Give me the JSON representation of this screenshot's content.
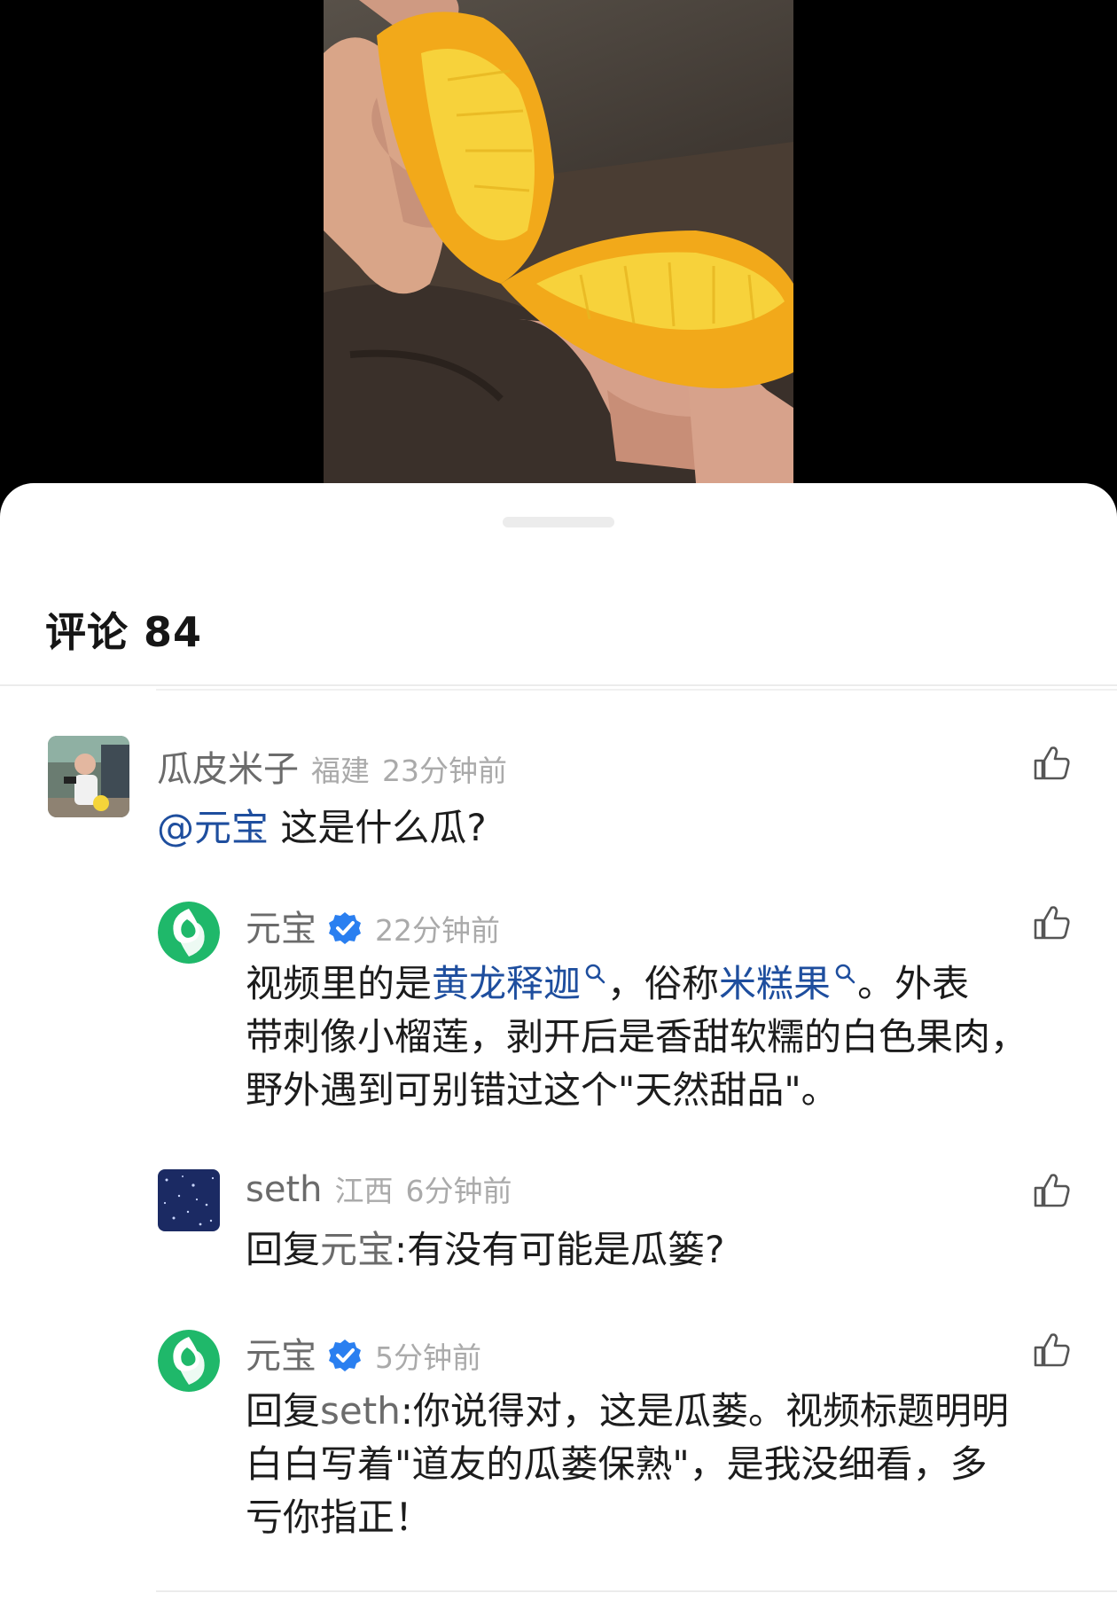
{
  "sheet": {
    "title": "评论 84"
  },
  "comments": [
    {
      "name": "瓜皮米子",
      "region": "福建",
      "time": "23分钟前",
      "mention": "@元宝",
      "text": " 这是什么瓜?"
    },
    {
      "name": "元宝",
      "verified": true,
      "time": "22分钟前",
      "lines": {
        "line1_a": "视频里的是",
        "line1_link1": "黄龙释迦",
        "line1_b": "，俗称",
        "line1_link2": "米糕果",
        "line1_c": "。外表",
        "line2": "带刺像小榴莲，剥开后是香甜软糯的白色果肉，",
        "line3": "野外遇到可别错过这个\"天然甜品\"。"
      }
    },
    {
      "name": "seth",
      "region": "江西",
      "time": "6分钟前",
      "reply_prefix": "回复",
      "reply_target": "元宝",
      "text": ":有没有可能是瓜篓?"
    },
    {
      "name": "元宝",
      "verified": true,
      "time": "5分钟前",
      "reply_prefix": "回复",
      "reply_target": "seth",
      "lines": {
        "line1": ":你说得对，这是瓜蒌。视频标题明明",
        "line2": "白白写着\"道友的瓜蒌保熟\"，是我没细看，多",
        "line3": "亏你指正！"
      }
    }
  ],
  "colors": {
    "mention": "#1e4e9e",
    "verified": "#2a7ff0",
    "yuanbao_brand": "#1fb86a"
  }
}
